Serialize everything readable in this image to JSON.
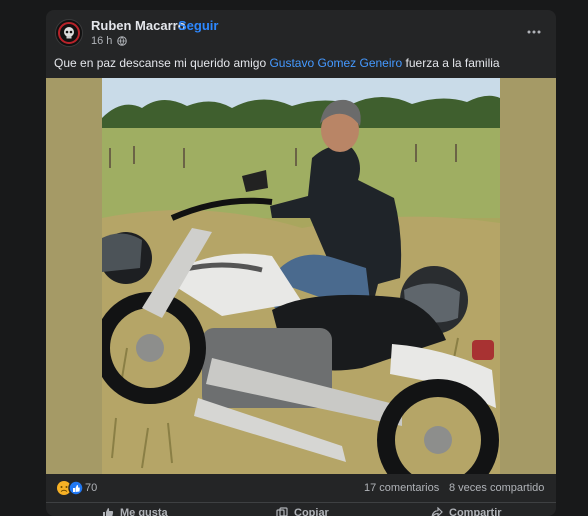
{
  "post": {
    "author": "Ruben Macarro",
    "separator": "·",
    "follow_label": "Seguir",
    "time": "16 h",
    "caption_before": "Que en paz descanse mi querido amigo ",
    "mention": "Gustavo Gomez Geneiro",
    "caption_after": " fuerza a la familia",
    "reactions": {
      "icons": [
        "sad-reaction-icon",
        "like-reaction-icon"
      ],
      "count": "70"
    },
    "comments": "17 comentarios",
    "shares": "8 veces compartido"
  },
  "actions": {
    "like": "Me gusta",
    "copy": "Copiar",
    "share": "Compartir"
  },
  "colors": {
    "page_bg": "#18191a",
    "card_bg": "#242526",
    "link": "#2d88ff",
    "photo_bg": "#a59a66"
  },
  "icons": {
    "avatar": "skull-biker-logo",
    "audience": "globe-icon",
    "menu": "more-horizontal-icon",
    "like_action": "thumbs-up-icon",
    "copy_action": "copy-icon",
    "share_action": "share-icon"
  }
}
